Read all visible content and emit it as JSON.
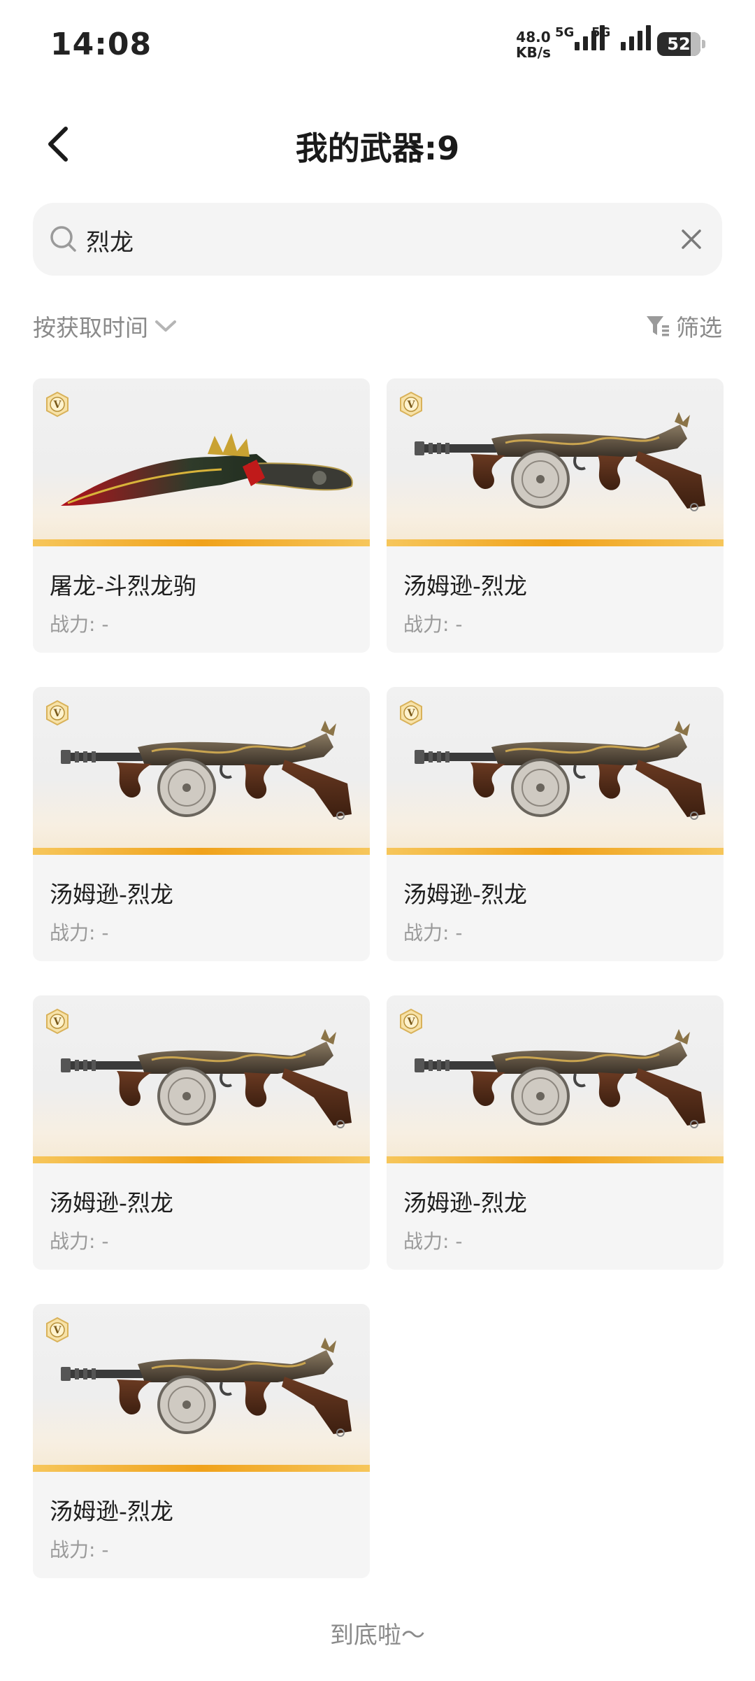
{
  "status_bar": {
    "time": "14:08",
    "speed_value": "48.0",
    "speed_unit": "KB/s",
    "net_label_1": "5G",
    "net_label_2": "5G",
    "battery": "52"
  },
  "header": {
    "title": "我的武器:9"
  },
  "search": {
    "value": "烈龙"
  },
  "toolbar": {
    "sort_label": "按获取时间",
    "filter_label": "筛选"
  },
  "weapons": [
    {
      "name": "屠龙-斗烈龙驹",
      "power": "战力: -",
      "type": "knife-icon"
    },
    {
      "name": "汤姆逊-烈龙",
      "power": "战力: -",
      "type": "smg-icon"
    },
    {
      "name": "汤姆逊-烈龙",
      "power": "战力: -",
      "type": "smg-icon"
    },
    {
      "name": "汤姆逊-烈龙",
      "power": "战力: -",
      "type": "smg-icon"
    },
    {
      "name": "汤姆逊-烈龙",
      "power": "战力: -",
      "type": "smg-icon"
    },
    {
      "name": "汤姆逊-烈龙",
      "power": "战力: -",
      "type": "smg-icon"
    },
    {
      "name": "汤姆逊-烈龙",
      "power": "战力: -",
      "type": "smg-icon"
    }
  ],
  "footer": {
    "end_text": "到底啦～"
  },
  "colors": {
    "accent": "#f0a21b",
    "card_bg": "#f5f5f5",
    "muted_text": "#8a8a8a"
  }
}
